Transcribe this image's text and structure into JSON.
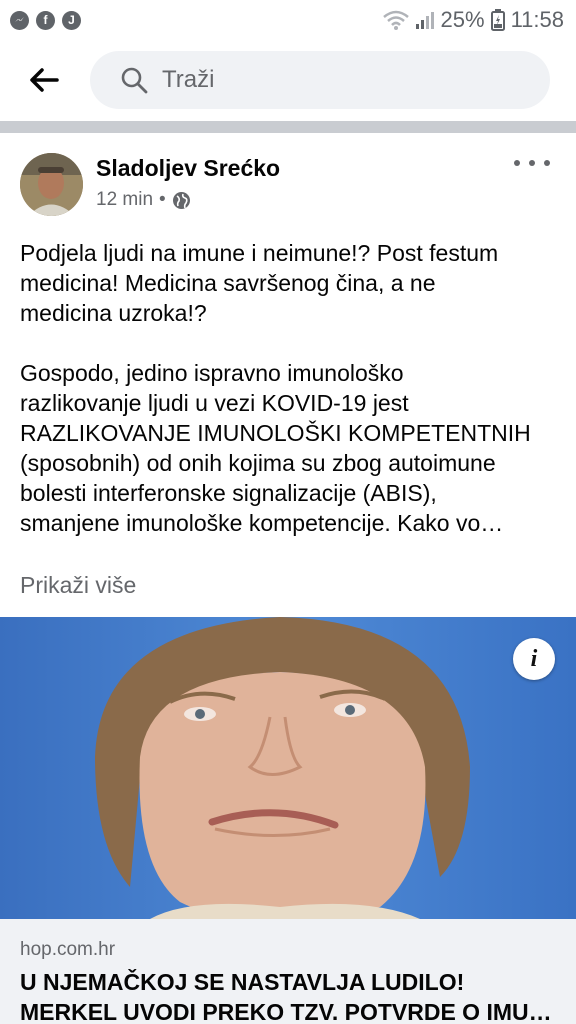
{
  "status_bar": {
    "left_icons": [
      "messenger-icon",
      "facebook-icon",
      "j-app-icon"
    ],
    "battery": "25%",
    "time": "11:58"
  },
  "search": {
    "placeholder": "Traži"
  },
  "post": {
    "author": "Sladoljev Srećko",
    "time": "12 min",
    "separator": "•",
    "text_paragraph_1": "Podjela ljudi na imune i neimune!? Post festum\nmedicina! Medicina savršenog čina, a ne\nmedicina uzroka!?",
    "text_paragraph_2": "Gospodo, jedino ispravno imunološko\nrazlikovanje ljudi u vezi KOVID-19 jest\nRAZLIKOVANJE IMUNOLOŠKI KOMPETENTNIH\n(sposobnih) od onih kojima su zbog autoimune\nbolesti interferonske signalizacije (ABIS),\nsmanjene imunološke kompetencije. Kako vo…",
    "see_more": "Prikaži više"
  },
  "link": {
    "info_label": "i",
    "domain": "hop.com.hr",
    "title_line_1": "U NJEMAČKOJ SE NASTAVLJA LUDILO!",
    "title_line_2": "MERKEL UVODI PREKO TZV. POTVRDE O IMU…"
  },
  "colors": {
    "background": "#ffffff",
    "divider": "#c9ccd1",
    "secondary_text": "#65676b",
    "link_background": "#f0f2f5",
    "image_background": "#3f78c7"
  }
}
